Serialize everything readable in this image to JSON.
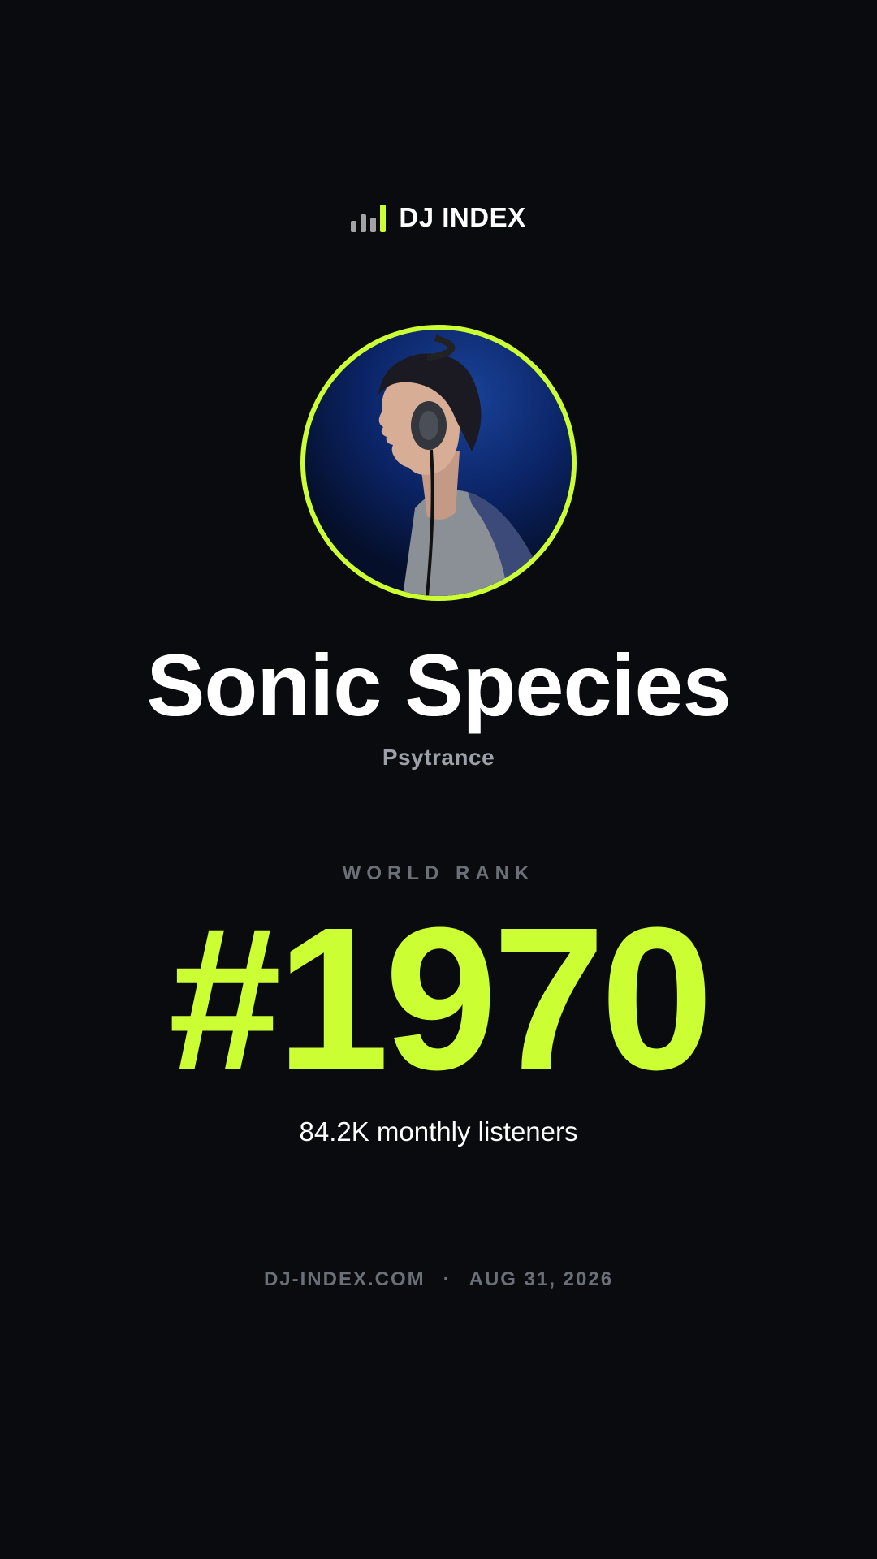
{
  "brand": {
    "name": "DJ INDEX",
    "icon": "bar-chart-icon",
    "accent_color": "#ccff33"
  },
  "artist": {
    "photo": "dj-profile-photo",
    "name": "Sonic Species",
    "genre": "Psytrance"
  },
  "rank": {
    "label": "WORLD RANK",
    "value": "#1970"
  },
  "stats": {
    "listeners": "84.2K monthly listeners"
  },
  "footer": {
    "site": "DJ-INDEX.COM",
    "separator": "·",
    "date": "AUG 31, 2026"
  },
  "colors": {
    "background": "#0a0b0e",
    "accent": "#ccff33",
    "muted": "#6b6f78"
  }
}
